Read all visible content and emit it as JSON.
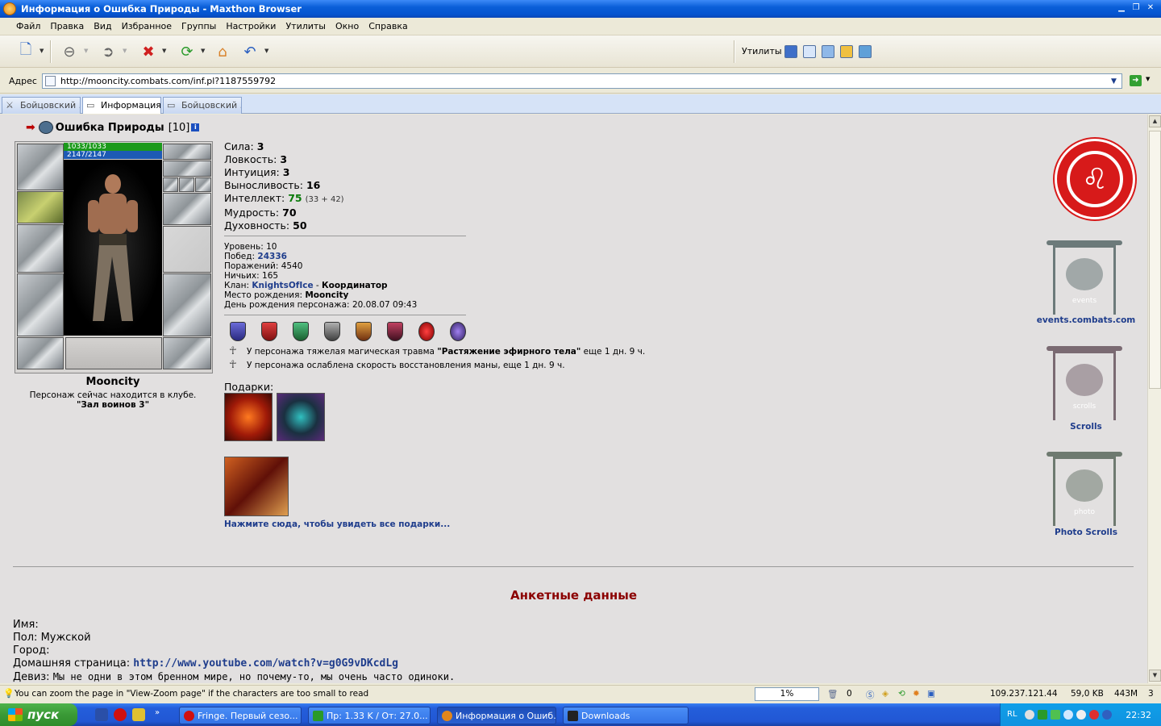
{
  "window": {
    "title": "Информация о Ошибка Природы - Maxthon Browser"
  },
  "menu": [
    "Файл",
    "Правка",
    "Вид",
    "Избранное",
    "Группы",
    "Настройки",
    "Утилиты",
    "Окно",
    "Справка"
  ],
  "toolbar": {
    "utilities_label": "Утилиты"
  },
  "address": {
    "label": "Адрес",
    "url": "http://mooncity.combats.com/inf.pl?1187559792"
  },
  "tabs": [
    {
      "label": "Бойцовский ..."
    },
    {
      "label": "Информация..."
    },
    {
      "label": "Бойцовский ..."
    }
  ],
  "character": {
    "name": "Ошибка Природы",
    "level": "[10]",
    "hp": "1033/1033",
    "mana": "2147/2147",
    "city": "Mooncity",
    "location_text": "Персонаж сейчас находится в клубе.",
    "room": "\"Зал воинов 3\""
  },
  "stats": [
    {
      "label": "Сила:",
      "value": "3"
    },
    {
      "label": "Ловкость:",
      "value": "3"
    },
    {
      "label": "Интуиция:",
      "value": "3"
    },
    {
      "label": "Выносливость:",
      "value": "16"
    },
    {
      "label": "Интеллект:",
      "value": "75",
      "extra": "(33 + 42)"
    },
    {
      "label": "Мудрость:",
      "value": "70"
    },
    {
      "label": "Духовность:",
      "value": "50"
    }
  ],
  "info": {
    "level_label": "Уровень:",
    "level": "10",
    "wins_label": "Побед:",
    "wins": "24336",
    "losses_label": "Поражений:",
    "losses": "4540",
    "draws_label": "Ничьих:",
    "draws": "165",
    "clan_label": "Клан:",
    "clan": "KnightsOfIce",
    "clan_sep": " - ",
    "clan_role": "Координатор",
    "birthplace_label": "Место рождения:",
    "birthplace": "Mooncity",
    "birthday_label": "День рождения персонажа:",
    "birthday": "20.08.07 09:43"
  },
  "effects": [
    {
      "pre": "У персонажа тяжелая магическая травма ",
      "bold": "\"Растяжение эфирного тела\"",
      "post": " еще 1 дн. 9 ч."
    },
    {
      "pre": "У персонажа ослаблена скорость восстановления маны, еще 1 дн. 9 ч.",
      "bold": "",
      "post": ""
    }
  ],
  "gifts": {
    "label": "Подарки:",
    "link": "Нажмите сюда, чтобы увидеть все подарки..."
  },
  "banners": [
    {
      "caption": "events",
      "label": "events.combats.com"
    },
    {
      "caption": "scrolls",
      "label": "Scrolls"
    },
    {
      "caption": "photo",
      "label": "Photo Scrolls"
    }
  ],
  "profile": {
    "heading": "Анкетные данные",
    "name_label": "Имя:",
    "gender_label": "Пол:",
    "gender": "Мужской",
    "city_label": "Город:",
    "homepage_label": "Домашняя страница:",
    "homepage": "http://www.youtube.com/watch?v=g0G9vDKcdLg",
    "motto_label": "Девиз:",
    "motto": "Мы не одни в этом бренном мире, но почему-то, мы очень часто одиноки."
  },
  "statusbar": {
    "message": "You can zoom the page in \"View-Zoom page\" if the characters are too small to read",
    "zoom": "1%",
    "count": "0",
    "ip": "109.237.121.44",
    "size": "59,0 KB",
    "mem": "443M",
    "tabs_count": "3"
  },
  "taskbar": {
    "start": "пуск",
    "tasks": [
      {
        "label": "Fringe. Первый сезо..."
      },
      {
        "label": "Пр: 1.33 K / От: 27.0..."
      },
      {
        "label": "Информация о Ошиб..."
      },
      {
        "label": "Downloads"
      }
    ],
    "lang": "RL",
    "clock": "22:32"
  },
  "colors": {
    "title_bar": "#0554d0",
    "link": "#1f3d8c",
    "heading": "#8b0000",
    "content_bg": "#e2e0e0",
    "hp": "#1b9a1b",
    "mana": "#1d5ab4"
  }
}
